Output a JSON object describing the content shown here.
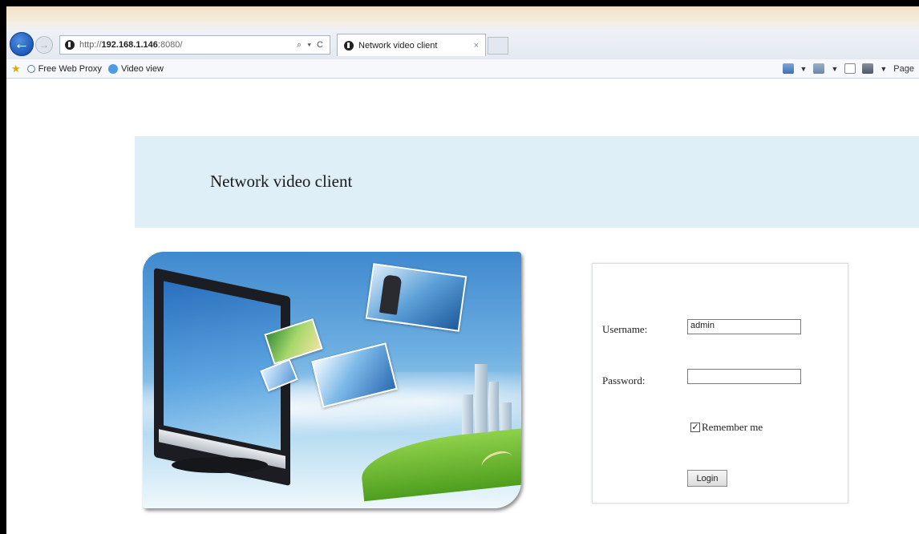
{
  "browser": {
    "address_url_prefix": "http://",
    "address_url_host": "192.168.1.146",
    "address_url_port": ":8080/",
    "address_tools": "⌕ ▾ C",
    "tab_title": "Network video client",
    "tab_close": "×",
    "back_glyph": "←",
    "forward_glyph": "→",
    "favorites": [
      {
        "label": "Free Web Proxy",
        "icon": "search-icon"
      },
      {
        "label": "Video view",
        "icon": "ie-page-icon"
      }
    ],
    "commandbar": {
      "page_label": "Page"
    }
  },
  "page": {
    "title": "Network video client"
  },
  "login": {
    "username_label": "Username:",
    "username_value": "admin",
    "password_label": "Password:",
    "password_value": "",
    "remember_label": "Remember me",
    "remember_checked": true,
    "check_glyph": "✓",
    "login_button": "Login"
  },
  "colors": {
    "header_band": "#dfeff7",
    "back_button": "#1d5ab8"
  }
}
